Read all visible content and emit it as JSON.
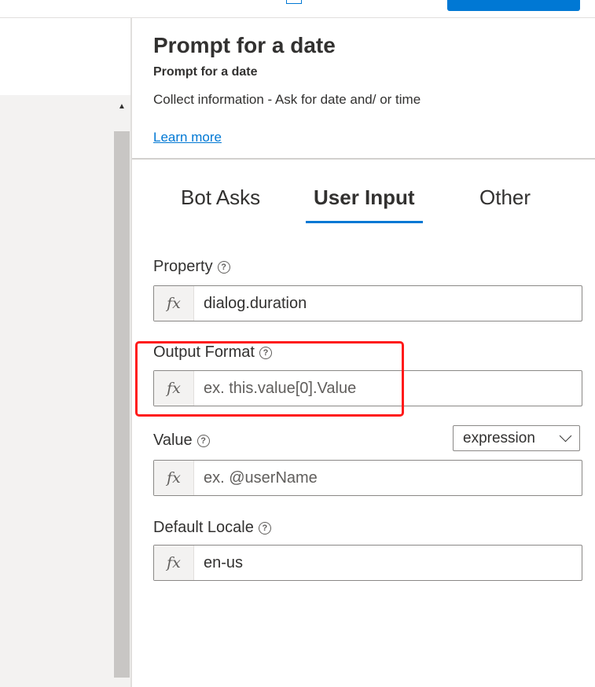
{
  "panel": {
    "title": "Prompt for a date",
    "subtitle": "Prompt for a date",
    "description": "Collect information - Ask for date and/ or time",
    "learn_more": "Learn more"
  },
  "tabs": [
    {
      "label": "Bot Asks",
      "active": false
    },
    {
      "label": "User Input",
      "active": true
    },
    {
      "label": "Other",
      "active": false
    }
  ],
  "fields": {
    "property": {
      "label": "Property",
      "value": "dialog.duration",
      "placeholder": ""
    },
    "output_format": {
      "label": "Output Format",
      "value": "",
      "placeholder": "ex. this.value[0].Value"
    },
    "value": {
      "label": "Value",
      "value": "",
      "placeholder": "ex. @userName",
      "type_selected": "expression"
    },
    "default_locale": {
      "label": "Default Locale",
      "value": "en-us",
      "placeholder": ""
    }
  },
  "fx_symbol": "fx",
  "help_symbol": "?",
  "colors": {
    "accent": "#0078d4",
    "highlight": "#ff1a1a"
  },
  "icons": [
    "help-icon",
    "chevron-down-icon",
    "scroll-up-icon",
    "fx-icon"
  ]
}
